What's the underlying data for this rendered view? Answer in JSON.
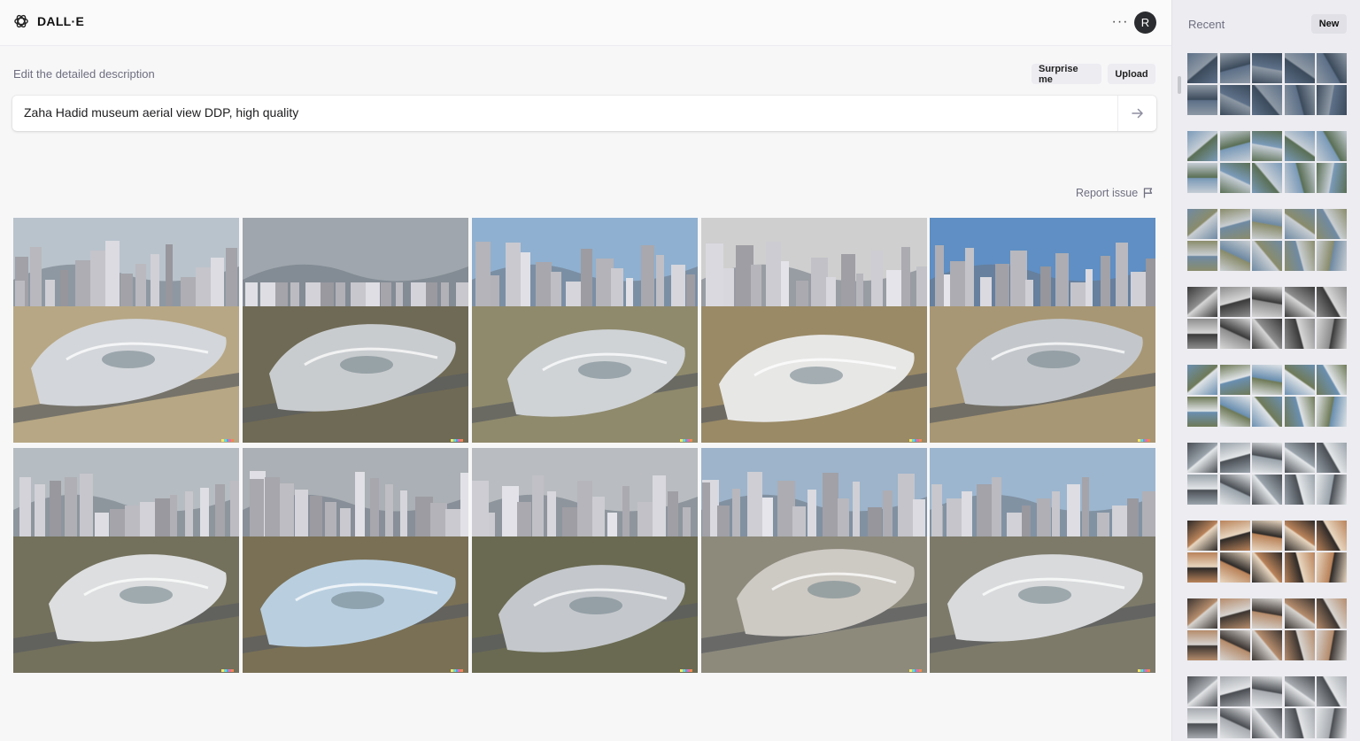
{
  "app": {
    "title": "DALL·E",
    "avatar_initial": "R",
    "more_label": "···"
  },
  "editor": {
    "description_label": "Edit the detailed description",
    "surprise_label": "Surprise me",
    "upload_label": "Upload",
    "prompt_value": "Zaha Hadid museum aerial view DDP, high quality",
    "report_label": "Report issue"
  },
  "sidebar": {
    "recent_label": "Recent",
    "new_label": "New"
  },
  "results": {
    "count": 10,
    "themes": [
      {
        "sky": "#b9c3cc",
        "ground": "#b7a784",
        "building": "#d3d6da"
      },
      {
        "sky": "#9fa6ad",
        "ground": "#6f6a55",
        "building": "#c9cccf"
      },
      {
        "sky": "#8fb0d0",
        "ground": "#8f8a6c",
        "building": "#cfd3d6"
      },
      {
        "sky": "#cfcfcf",
        "ground": "#9a8a66",
        "building": "#e7e7e6"
      },
      {
        "sky": "#5f8fc4",
        "ground": "#a89774",
        "building": "#c3c7cb"
      },
      {
        "sky": "#b5bcc2",
        "ground": "#73705c",
        "building": "#dcdedf"
      },
      {
        "sky": "#aab0b5",
        "ground": "#7a7055",
        "building": "#b9cfe0"
      },
      {
        "sky": "#b9bdc1",
        "ground": "#6a6a52",
        "building": "#c4c8cc"
      },
      {
        "sky": "#9db4cb",
        "ground": "#8d8a7c",
        "building": "#cdc9c3"
      },
      {
        "sky": "#9cb6cf",
        "ground": "#7d7a6a",
        "building": "#d8dadc"
      }
    ]
  },
  "recent_groups": [
    {
      "palette": [
        "#5d7088",
        "#8d98a4",
        "#3c4b5c"
      ]
    },
    {
      "palette": [
        "#7a9ab8",
        "#c5cdd5",
        "#5a6f55"
      ]
    },
    {
      "palette": [
        "#6f8aa3",
        "#8a8c6b",
        "#c9ced2"
      ]
    },
    {
      "palette": [
        "#3a3a3a",
        "#8e8e8e",
        "#d6d6d6"
      ]
    },
    {
      "palette": [
        "#6a8fb0",
        "#6f7a58",
        "#dfe3e6"
      ]
    },
    {
      "palette": [
        "#4a4f55",
        "#9aa3ab",
        "#e3e6e8"
      ]
    },
    {
      "palette": [
        "#2e2a28",
        "#b9835a",
        "#e8d6c0"
      ]
    },
    {
      "palette": [
        "#3c3531",
        "#b58c6c",
        "#d7d3cf"
      ]
    },
    {
      "palette": [
        "#4a4d52",
        "#a7abb0",
        "#e2e4e6"
      ]
    }
  ]
}
